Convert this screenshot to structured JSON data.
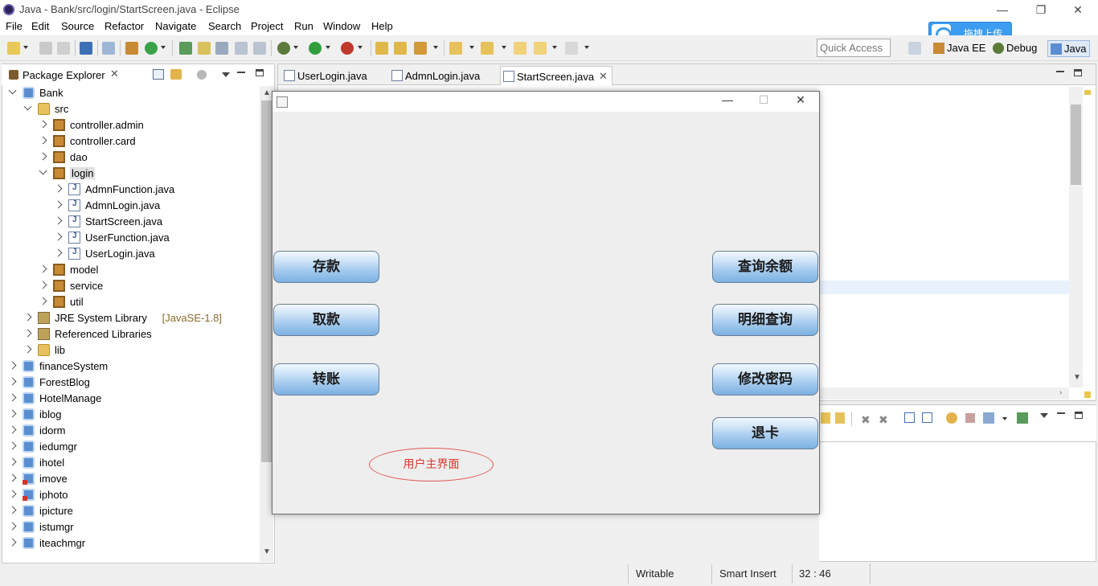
{
  "window": {
    "title": "Java - Bank/src/login/StartScreen.java - Eclipse",
    "controls": [
      "—",
      "❐",
      "✕"
    ]
  },
  "menu": [
    "File",
    "Edit",
    "Source",
    "Refactor",
    "Navigate",
    "Search",
    "Project",
    "Run",
    "Window",
    "Help"
  ],
  "toolbar": {
    "quick_access_placeholder": "Quick Access",
    "perspectives": [
      "Java EE",
      "Debug",
      "Java"
    ],
    "upload_label": "拖拽上传"
  },
  "package_explorer": {
    "title": "Package Explorer",
    "close": "✕",
    "tree": [
      {
        "label": "Bank",
        "icon": "project",
        "level": 0,
        "expanded": true
      },
      {
        "label": "src",
        "icon": "source-folder",
        "level": 1,
        "expanded": true
      },
      {
        "label": "controller.admin",
        "icon": "package",
        "level": 2,
        "expanded": false
      },
      {
        "label": "controller.card",
        "icon": "package",
        "level": 2,
        "expanded": false
      },
      {
        "label": "dao",
        "icon": "package",
        "level": 2,
        "expanded": false
      },
      {
        "label": "login",
        "icon": "package",
        "level": 2,
        "expanded": true,
        "selected": true
      },
      {
        "label": "AdmnFunction.java",
        "icon": "java-file",
        "level": 3,
        "expanded": false
      },
      {
        "label": "AdmnLogin.java",
        "icon": "java-file",
        "level": 3,
        "expanded": false
      },
      {
        "label": "StartScreen.java",
        "icon": "java-file",
        "level": 3,
        "expanded": false
      },
      {
        "label": "UserFunction.java",
        "icon": "java-file",
        "level": 3,
        "expanded": false
      },
      {
        "label": "UserLogin.java",
        "icon": "java-file",
        "level": 3,
        "expanded": false
      },
      {
        "label": "model",
        "icon": "package",
        "level": 2,
        "expanded": false
      },
      {
        "label": "service",
        "icon": "package",
        "level": 2,
        "expanded": false
      },
      {
        "label": "util",
        "icon": "package",
        "level": 2,
        "expanded": false
      },
      {
        "label": "JRE System Library",
        "suffix": "[JavaSE-1.8]",
        "icon": "library",
        "level": 1,
        "expanded": false
      },
      {
        "label": "Referenced Libraries",
        "icon": "library",
        "level": 1,
        "expanded": false
      },
      {
        "label": "lib",
        "icon": "folder",
        "level": 1,
        "expanded": false
      },
      {
        "label": "financeSystem",
        "icon": "project",
        "level": 0,
        "expanded": false
      },
      {
        "label": "ForestBlog",
        "icon": "project",
        "level": 0,
        "expanded": false
      },
      {
        "label": "HotelManage",
        "icon": "project",
        "level": 0,
        "expanded": false
      },
      {
        "label": "iblog",
        "icon": "project",
        "level": 0,
        "expanded": false
      },
      {
        "label": "idorm",
        "icon": "project",
        "level": 0,
        "expanded": false
      },
      {
        "label": "iedumgr",
        "icon": "project",
        "level": 0,
        "expanded": false
      },
      {
        "label": "ihotel",
        "icon": "project",
        "level": 0,
        "expanded": false
      },
      {
        "label": "imove",
        "icon": "project-error",
        "level": 0,
        "expanded": false
      },
      {
        "label": "iphoto",
        "icon": "project-error",
        "level": 0,
        "expanded": false
      },
      {
        "label": "ipicture",
        "icon": "project",
        "level": 0,
        "expanded": false
      },
      {
        "label": "istumgr",
        "icon": "project",
        "level": 0,
        "expanded": false
      },
      {
        "label": "iteachmgr",
        "icon": "project",
        "level": 0,
        "expanded": false
      }
    ]
  },
  "editor": {
    "tabs": [
      {
        "label": "UserLogin.java",
        "active": false
      },
      {
        "label": "AdmnLogin.java",
        "active": false
      },
      {
        "label": "StartScreen.java",
        "active": true
      }
    ],
    "tab_close": "✕"
  },
  "status_bar": {
    "mode": "Writable",
    "insert_mode": "Smart Insert",
    "position": "32 : 46"
  },
  "dialog": {
    "controls": [
      "—",
      "☐",
      "✕"
    ],
    "background_label": "background",
    "buttons_left": [
      "存款",
      "取款",
      "转账"
    ],
    "buttons_right": [
      "查询余额",
      "明细查询",
      "修改密码",
      "退卡"
    ],
    "caption": "用户主界面",
    "caption_color": "#d9362f"
  }
}
